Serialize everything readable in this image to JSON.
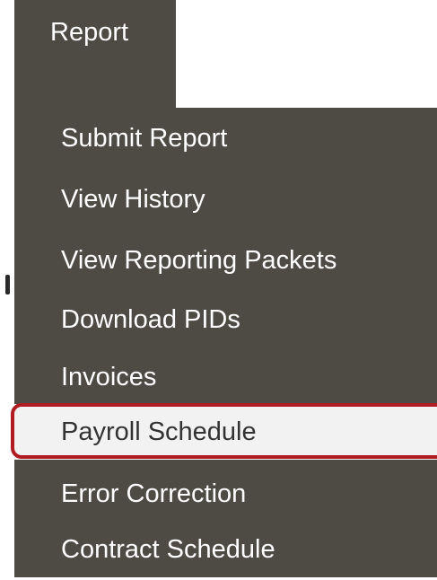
{
  "nav": {
    "report_tab_label": "Report"
  },
  "menu": {
    "items": [
      {
        "label": "Submit Report"
      },
      {
        "label": "View History"
      },
      {
        "label": "View Reporting Packets"
      },
      {
        "label": "Download PIDs"
      },
      {
        "label": "Invoices"
      },
      {
        "label": "Payroll Schedule",
        "highlighted": true
      },
      {
        "label": "Error Correction"
      },
      {
        "label": "Contract Schedule"
      }
    ]
  },
  "colors": {
    "menu_background": "#4e4b44",
    "menu_text": "#ffffff",
    "active_item_background": "#f2f2f2",
    "highlight_outline": "#b01c22"
  }
}
